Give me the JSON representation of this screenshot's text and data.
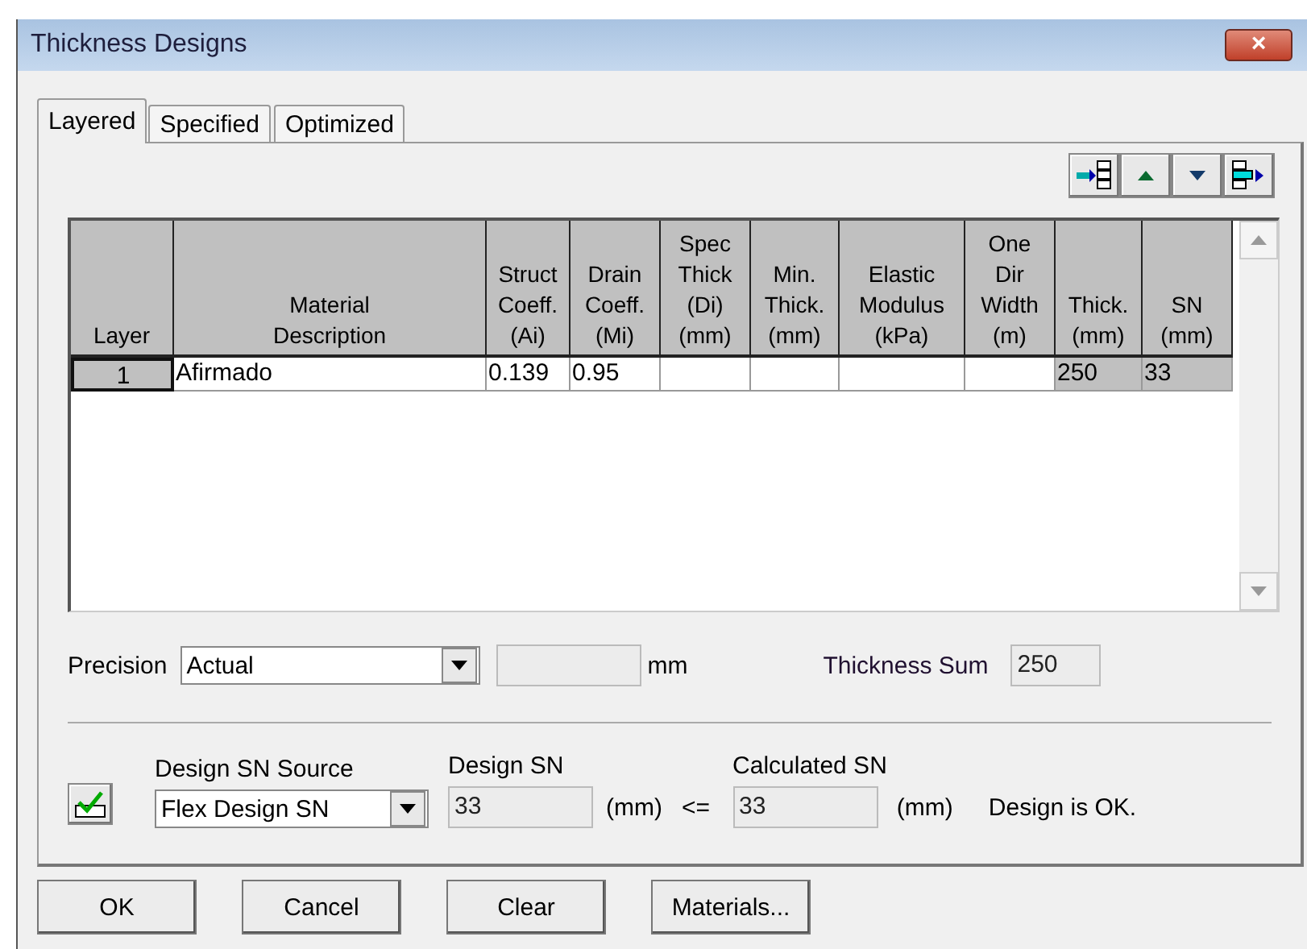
{
  "window": {
    "title": "Thickness Designs",
    "close": "×"
  },
  "tabs": [
    {
      "label": "Layered",
      "selected": true
    },
    {
      "label": "Specified",
      "selected": false
    },
    {
      "label": "Optimized",
      "selected": false
    }
  ],
  "table": {
    "columns": [
      "Layer",
      "Material\nDescription",
      "Struct\nCoeff.\n(Ai)",
      "Drain\nCoeff.\n(Mi)",
      "Spec\nThick\n(Di)\n(mm)",
      "Min.\nThick.\n(mm)",
      "Elastic\nModulus\n(kPa)",
      "One\nDir\nWidth\n(m)",
      "Thick.\n(mm)",
      "SN\n(mm)"
    ],
    "rows": [
      [
        "1",
        "Afirmado",
        "0.139",
        "0.95",
        "",
        "",
        "",
        "",
        "250",
        "33"
      ]
    ]
  },
  "precision": {
    "label": "Precision",
    "value": "Actual",
    "unit": "mm",
    "sum_label": "Thickness Sum",
    "sum_value": "250"
  },
  "design": {
    "source_label": "Design SN Source",
    "source_value": "Flex Design SN",
    "design_label": "Design SN",
    "design_value": "33",
    "design_unit": "(mm)",
    "operator": "<=",
    "calc_label": "Calculated SN",
    "calc_value": "33",
    "calc_unit": "(mm)",
    "status": "Design is OK."
  },
  "buttons": [
    "OK",
    "Cancel",
    "Clear",
    "Materials..."
  ]
}
